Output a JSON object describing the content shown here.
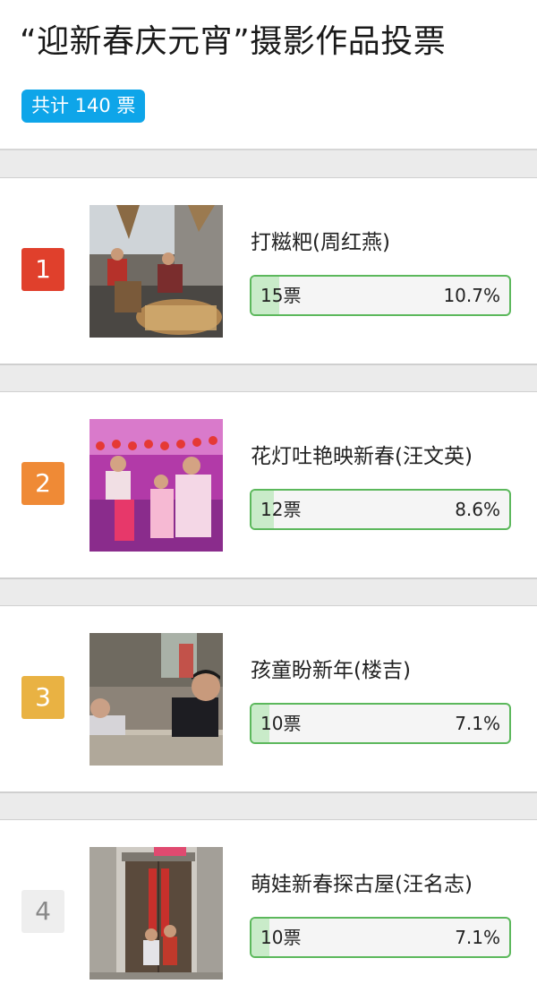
{
  "header": {
    "title": "“迎新春庆元宵”摄影作品投票",
    "total_votes": "共计 140 票",
    "badge_color": "#0ea5e9"
  },
  "entries": [
    {
      "rank": "1",
      "rank_color": "#e0402c",
      "title": "打糍粑(周红燕)",
      "votes": "15票",
      "percent": "10.7%",
      "fill_fraction": 0.107,
      "photo": "rice-cake-pounding-photo"
    },
    {
      "rank": "2",
      "rank_color": "#ef8a36",
      "title": "花灯吐艳映新春(汪文英)",
      "votes": "12票",
      "percent": "8.6%",
      "fill_fraction": 0.086,
      "photo": "lantern-street-family-photo"
    },
    {
      "rank": "3",
      "rank_color": "#e9b243",
      "title": "孩童盼新年(楼吉)",
      "votes": "10票",
      "percent": "7.1%",
      "fill_fraction": 0.071,
      "photo": "children-at-wall-photo"
    },
    {
      "rank": "4",
      "rank_color": "#eeeeee",
      "title": "萌娃新春探古屋(汪名志)",
      "votes": "10票",
      "percent": "7.1%",
      "fill_fraction": 0.071,
      "photo": "old-house-door-photo"
    }
  ],
  "colors": {
    "bar_border": "#5cb85c",
    "bar_fill": "#c9ebc9"
  }
}
